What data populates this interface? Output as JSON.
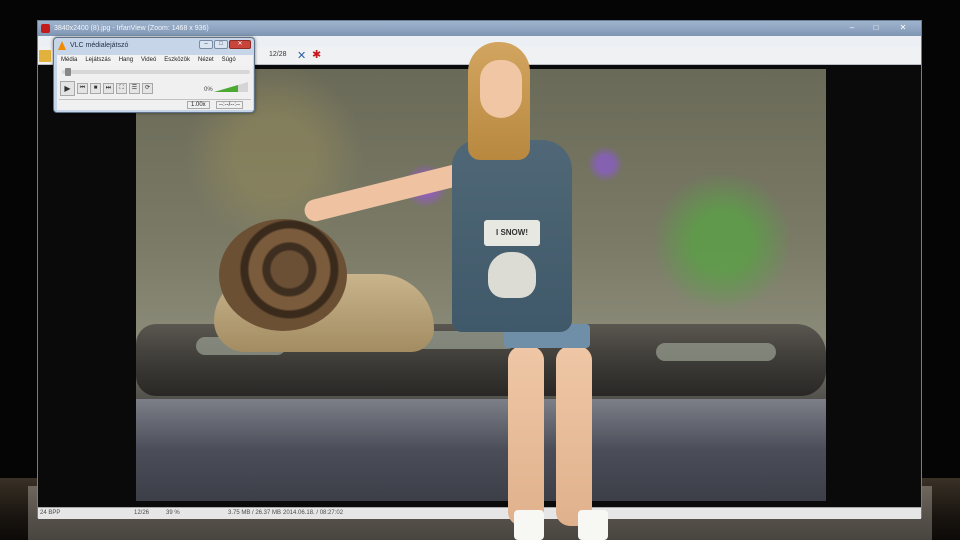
{
  "irfanview": {
    "title": "3840x2400 (8).jpg - IrfanView (Zoom: 1468 x 936)",
    "page_counter": "12/28",
    "status": {
      "bpp": "24 BPP",
      "index": "12/26",
      "zoom": "39 %",
      "size": "3.75 MB / 26.37 MB",
      "datetime": "2014.06.18. / 08:27:02"
    }
  },
  "vlc": {
    "title": "VLC médialejátszó",
    "menu": [
      "Média",
      "Lejátszás",
      "Hang",
      "Videó",
      "Eszközök",
      "Nézet",
      "Súgó"
    ],
    "speed": "1.00x",
    "time": "--:--/--:--",
    "volume_label": "0%"
  },
  "photo": {
    "shirt_text": "I SNOW!"
  }
}
